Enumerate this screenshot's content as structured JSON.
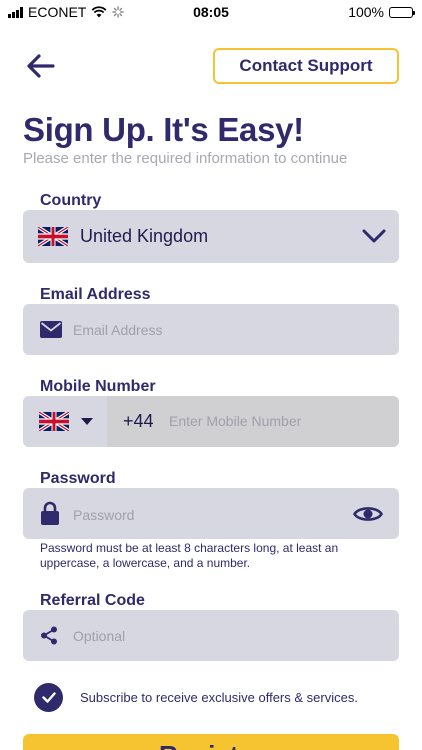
{
  "status_bar": {
    "carrier": "ECONET",
    "time": "08:05",
    "battery": "100%"
  },
  "header": {
    "back_icon": "arrow-left-icon",
    "contact_label": "Contact Support"
  },
  "title": "Sign Up. It's Easy!",
  "subtitle": "Please enter the required information to continue",
  "country": {
    "label": "Country",
    "value": "United Kingdom",
    "flag": "uk-flag-icon"
  },
  "email": {
    "label": "Email Address",
    "placeholder": "Email Address",
    "icon": "envelope-icon"
  },
  "mobile": {
    "label": "Mobile Number",
    "dial_code": "+44",
    "placeholder": "Enter Mobile Number",
    "flag": "uk-flag-icon"
  },
  "password": {
    "label": "Password",
    "placeholder": "Password",
    "hint": "Password must be at least 8 characters long, at least an uppercase, a lowercase, and a number.",
    "icon": "lock-icon"
  },
  "referral": {
    "label": "Referral Code",
    "placeholder": "Optional",
    "icon": "share-icon"
  },
  "subscribe": {
    "label": "Subscribe to receive exclusive offers & services.",
    "checked": true
  },
  "register": {
    "label": "Register"
  },
  "colors": {
    "primary": "#2f2a6b",
    "accent": "#f6c431",
    "field_bg": "#d6d7e0",
    "placeholder": "#a0a0ad"
  }
}
